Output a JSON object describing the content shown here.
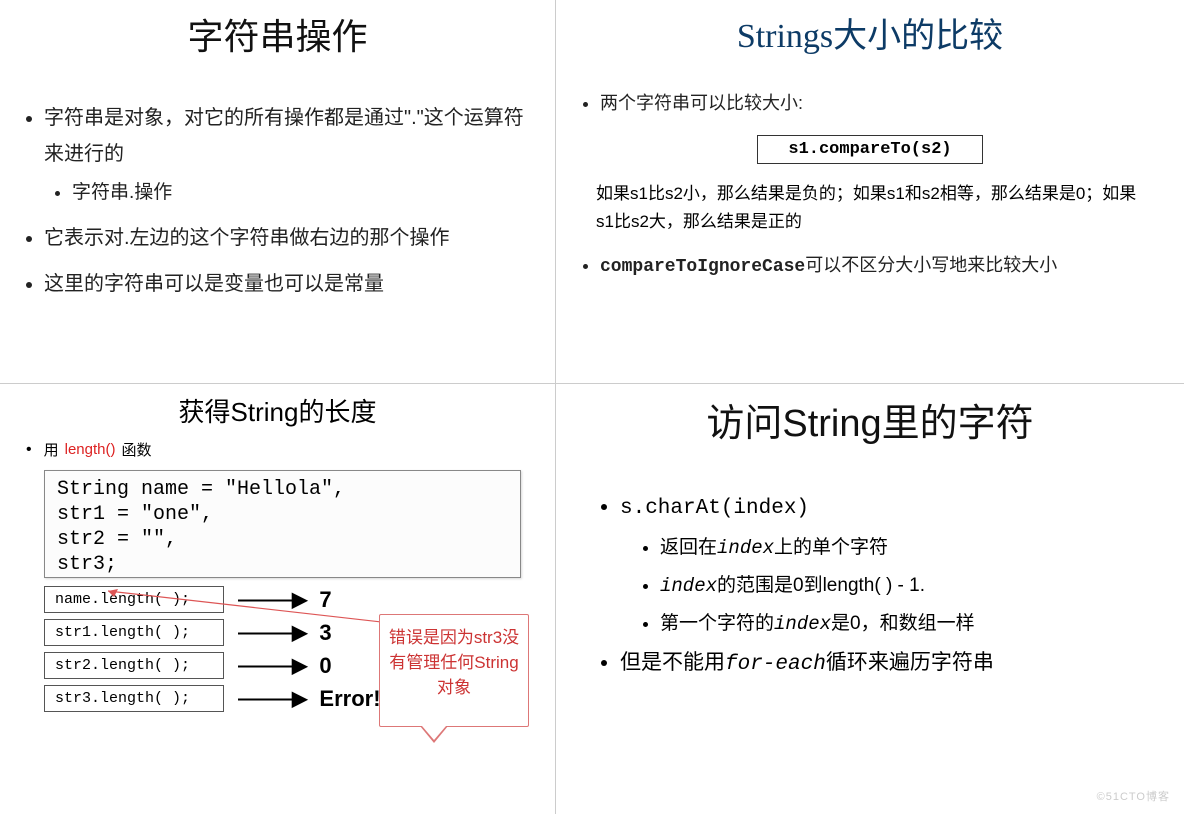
{
  "tl": {
    "title": "字符串操作",
    "b1": "字符串是对象，对它的所有操作都是通过\".\"这个运算符来进行的",
    "b1a": "字符串.操作",
    "b2": "它表示对.左边的这个字符串做右边的那个操作",
    "b3": "这里的字符串可以是变量也可以是常量"
  },
  "tr": {
    "title": "Strings大小的比较",
    "b1": "两个字符串可以比较大小:",
    "code": "s1.compareTo(s2)",
    "para": "如果s1比s2小，那么结果是负的；如果s1和s2相等，那么结果是0；如果s1比s2大，那么结果是正的",
    "b2a": "compareToIgnoreCase",
    "b2b": "可以不区分大小写地来比较大小"
  },
  "bl": {
    "title": "获得String的长度",
    "use_prefix": "用",
    "use_func": "length()",
    "use_suffix": " 函数",
    "code": "String name = \"Hellola\",\nstr1 = \"one\",\nstr2 = \"\",\nstr3;",
    "rows": [
      {
        "call": "name.length( );",
        "res": "7"
      },
      {
        "call": "str1.length( );",
        "res": "3"
      },
      {
        "call": "str2.length( );",
        "res": "0"
      },
      {
        "call": "str3.length( );",
        "res": "Error!"
      }
    ],
    "callout": "错误是因为str3没有管理任何String对象"
  },
  "br": {
    "title": "访问String里的字符",
    "b1": "s.charAt(index)",
    "s1a": "返回在",
    "s1b": "index",
    "s1c": "上的单个字符",
    "s2a": "index",
    "s2b": "的范围是0到length( ) - 1.",
    "s3a": "第一个字符的",
    "s3b": "index",
    "s3c": "是0，和数组一样",
    "b2a": "但是不能用",
    "b2b": "for-each",
    "b2c": "循环来遍历字符串"
  },
  "watermark": "©51CTO博客"
}
